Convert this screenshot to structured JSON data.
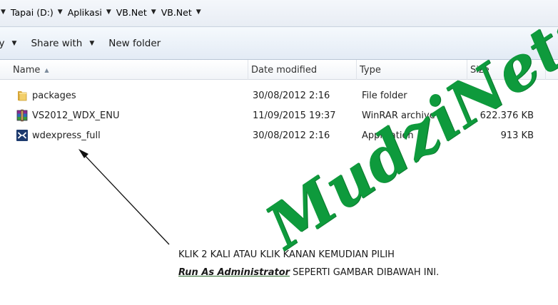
{
  "breadcrumb": {
    "items": [
      "Tapai (D:)",
      "Aplikasi",
      "VB.Net",
      "VB.Net"
    ]
  },
  "toolbar": {
    "organize_partial": "ry",
    "share_with": "Share with",
    "new_folder": "New folder"
  },
  "columns": {
    "name": "Name",
    "date_modified": "Date modified",
    "type": "Type",
    "size": "Size"
  },
  "files": [
    {
      "name": "packages",
      "date": "30/08/2012 2:16",
      "type": "File folder",
      "size": "",
      "icon": "folder-icon"
    },
    {
      "name": "VS2012_WDX_ENU",
      "date": "11/09/2015 19:37",
      "type": "WinRAR archive",
      "size": "622.376 KB",
      "icon": "winrar-archive-icon"
    },
    {
      "name": "wdexpress_full",
      "date": "30/08/2012 2:16",
      "type": "Application",
      "size": "913 KB",
      "icon": "visual-studio-icon"
    }
  ],
  "annotation": {
    "line1": "KLIK 2 KALI ATAU KLIK KANAN KEMUDIAN PILIH",
    "line2_emphasis": "Run  As Administrator",
    "line2_rest": " SEPERTI GAMBAR DIBAWAH  INI."
  },
  "watermark": {
    "text": "MudziNetz",
    "color": "#0e9a3c"
  }
}
